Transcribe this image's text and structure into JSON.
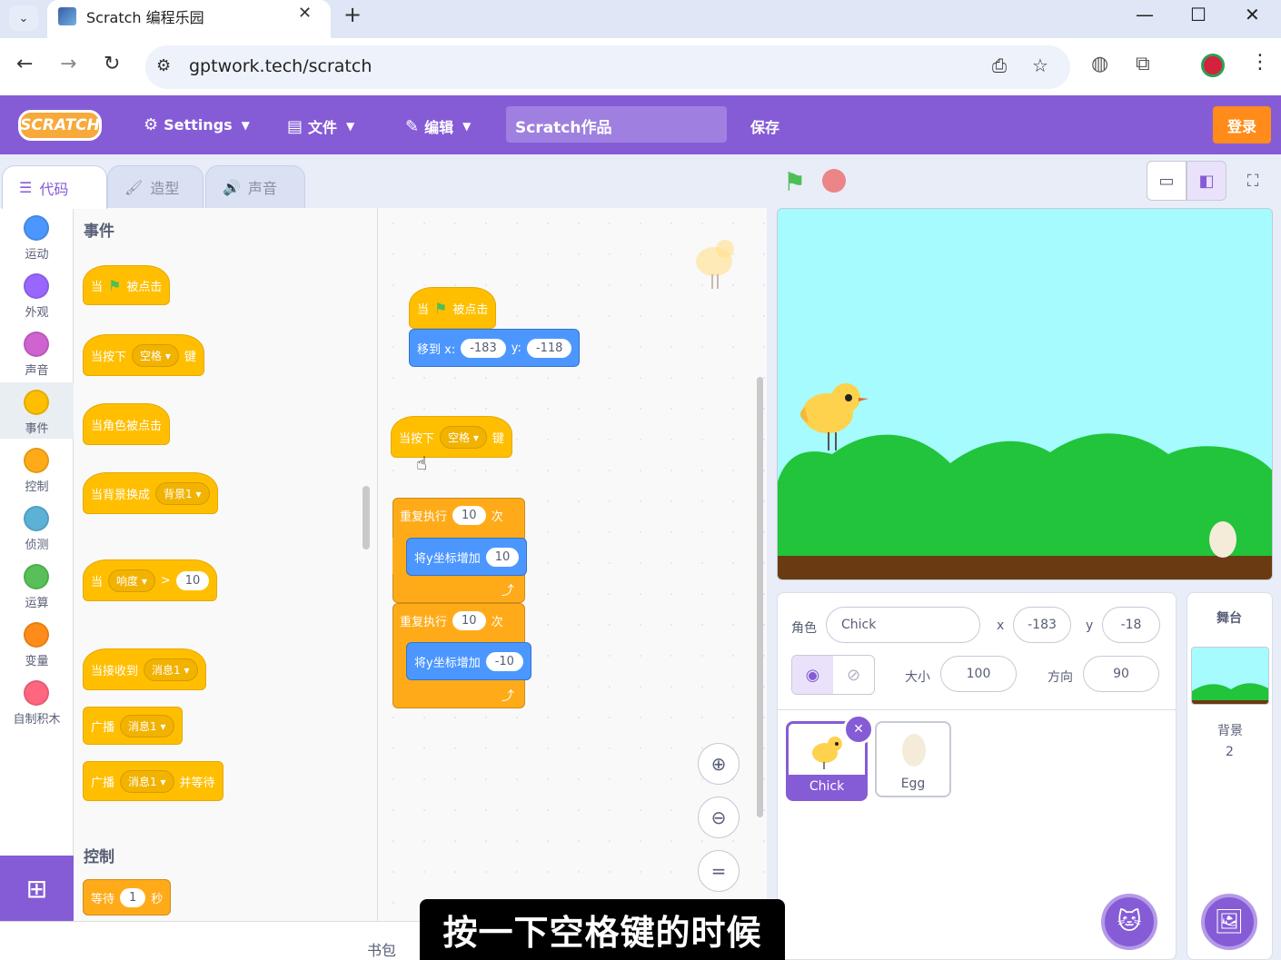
{
  "browser": {
    "tab_title": "Scratch 编程乐园",
    "url": "gptwork.tech/scratch"
  },
  "menu": {
    "settings": "Settings",
    "file": "文件",
    "edit": "编辑",
    "project_title": "Scratch作品",
    "save": "保存",
    "login": "登录",
    "logo_text": "SCRATCH"
  },
  "editor_tabs": {
    "code": "代码",
    "costumes": "造型",
    "sounds": "声音"
  },
  "categories": [
    {
      "label": "运动",
      "color": "#4c97ff"
    },
    {
      "label": "外观",
      "color": "#9966ff"
    },
    {
      "label": "声音",
      "color": "#cf63cf"
    },
    {
      "label": "事件",
      "color": "#ffbf00"
    },
    {
      "label": "控制",
      "color": "#ffab19"
    },
    {
      "label": "侦测",
      "color": "#5cb1d6"
    },
    {
      "label": "运算",
      "color": "#59c059"
    },
    {
      "label": "变量",
      "color": "#ff8c1a"
    },
    {
      "label": "自制积木",
      "color": "#ff6680"
    }
  ],
  "palette": {
    "events_heading": "事件",
    "control_heading": "控制",
    "when_flag_a": "当",
    "when_flag_b": "被点击",
    "when_key_a": "当按下",
    "when_key_dd": "空格",
    "when_key_b": "键",
    "when_sprite_clicked": "当角色被点击",
    "when_backdrop_a": "当背景换成",
    "when_backdrop_dd": "背景1",
    "when_loud_a": "当",
    "when_loud_dd": "响度",
    "when_loud_op": ">",
    "when_loud_val": "10",
    "when_receive_a": "当接收到",
    "when_receive_dd": "消息1",
    "broadcast_a": "广播",
    "broadcast_dd": "消息1",
    "broadcast_wait_a": "广播",
    "broadcast_wait_dd": "消息1",
    "broadcast_wait_b": "并等待",
    "wait_a": "等待",
    "wait_val": "1",
    "wait_b": "秒"
  },
  "scripts": {
    "s1_hat_a": "当",
    "s1_hat_b": "被点击",
    "s1_goto_a": "移到 x:",
    "s1_goto_x": "-183",
    "s1_goto_b": "y:",
    "s1_goto_y": "-118",
    "s2_hat_a": "当按下",
    "s2_hat_dd": "空格",
    "s2_hat_b": "键",
    "repeat1_a": "重复执行",
    "repeat1_val": "10",
    "repeat1_b": "次",
    "changey1_a": "将y坐标增加",
    "changey1_val": "10",
    "repeat2_a": "重复执行",
    "repeat2_val": "10",
    "repeat2_b": "次",
    "changey2_a": "将y坐标增加",
    "changey2_val": "-10"
  },
  "backpack": "书包",
  "sprite_info": {
    "sprite_label": "角色",
    "sprite_name": "Chick",
    "x_label": "x",
    "x_val": "-183",
    "y_label": "y",
    "y_val": "-18",
    "size_label": "大小",
    "size_val": "100",
    "direction_label": "方向",
    "direction_val": "90"
  },
  "sprites": [
    {
      "name": "Chick",
      "selected": true
    },
    {
      "name": "Egg",
      "selected": false
    }
  ],
  "stage_panel": {
    "title": "舞台",
    "backdrops_label": "背景",
    "backdrops_count": "2"
  },
  "subtitle": "按一下空格键的时候",
  "colors": {
    "scratch_purple": "#855cd6",
    "events_yellow": "#ffbf00",
    "control_orange": "#ffab19",
    "motion_blue": "#4c97ff",
    "login_orange": "#ff8c1a"
  }
}
